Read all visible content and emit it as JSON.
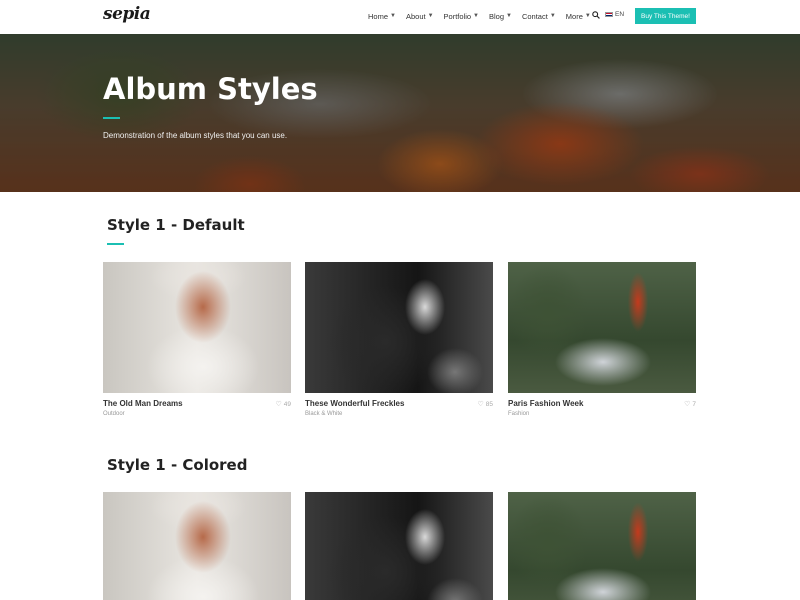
{
  "header": {
    "logo": "sepia",
    "nav": [
      {
        "label": "Home",
        "has_dropdown": true
      },
      {
        "label": "About",
        "has_dropdown": true
      },
      {
        "label": "Portfolio",
        "has_dropdown": true
      },
      {
        "label": "Blog",
        "has_dropdown": true
      },
      {
        "label": "Contact",
        "has_dropdown": true
      },
      {
        "label": "More",
        "has_dropdown": true
      }
    ],
    "search_icon": "search-icon",
    "language": "EN",
    "buy_label": "Buy This Theme!"
  },
  "hero": {
    "title": "Album Styles",
    "subtitle": "Demonstration of the album styles that you can use."
  },
  "colors": {
    "accent": "#1bbfb3"
  },
  "sections": [
    {
      "title": "Style 1 - Default",
      "cards": [
        {
          "title": "The Old Man Dreams",
          "category": "Outdoor",
          "likes": "49"
        },
        {
          "title": "These Wonderful Freckles",
          "category": "Black & White",
          "likes": "85"
        },
        {
          "title": "Paris Fashion Week",
          "category": "Fashion",
          "likes": "7"
        }
      ]
    },
    {
      "title": "Style 1 - Colored"
    }
  ]
}
